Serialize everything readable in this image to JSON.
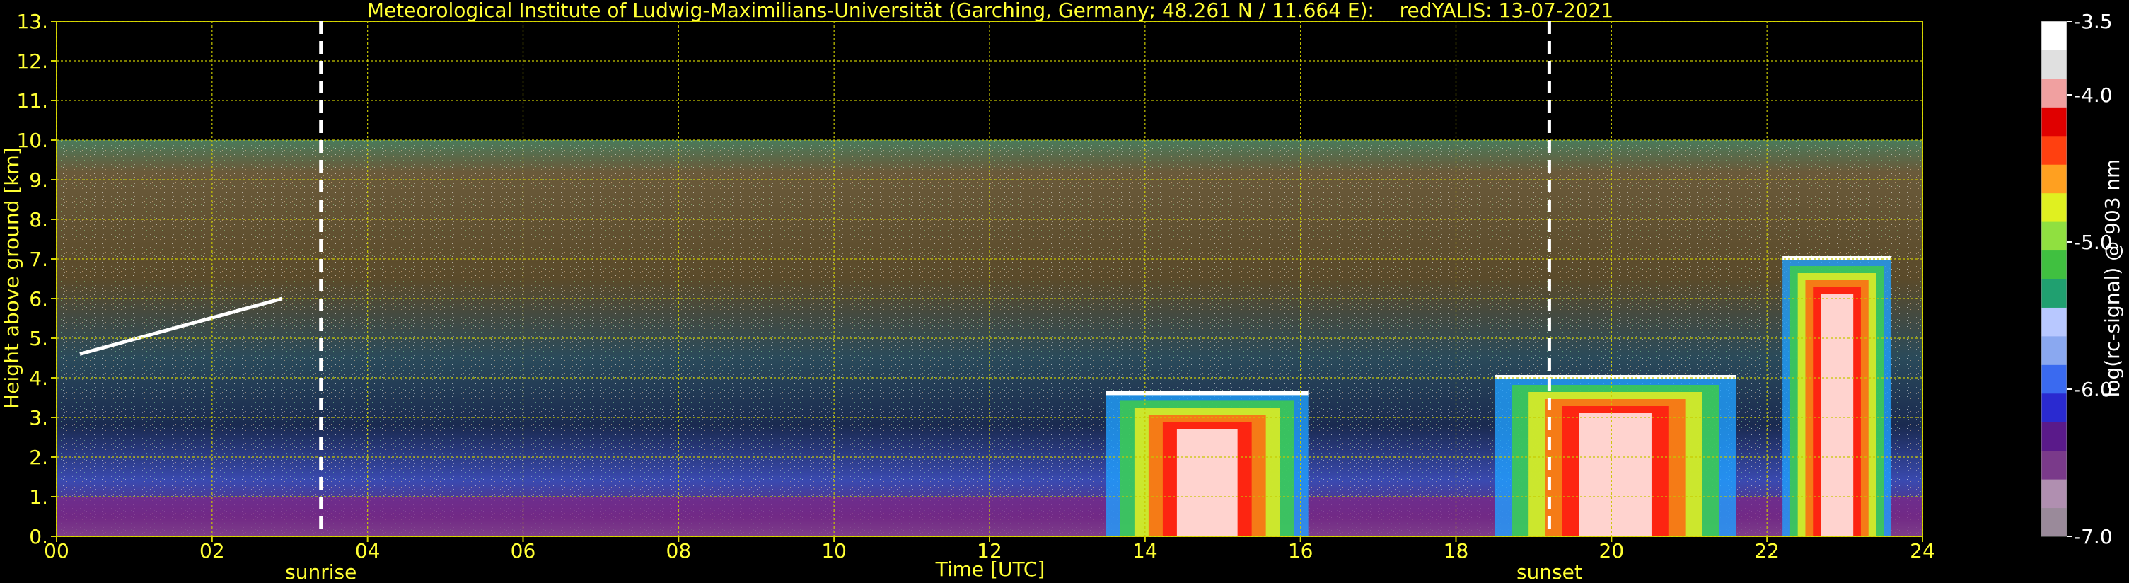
{
  "chart_data": {
    "type": "heatmap",
    "title": "Meteorological Institute of Ludwig-Maximilians-Universität (Garching, Germany; 48.261 N / 11.664 E):    redYALIS: 13-07-2021",
    "xlabel": "Time [UTC]",
    "ylabel": "Height above ground [km]",
    "xlim": [
      0,
      24
    ],
    "ylim": [
      0,
      13
    ],
    "x_ticks": [
      "00",
      "02",
      "04",
      "06",
      "08",
      "10",
      "12",
      "14",
      "16",
      "18",
      "20",
      "22",
      "24"
    ],
    "y_ticks": [
      "0.",
      "1.",
      "2.",
      "3.",
      "4.",
      "5.",
      "6.",
      "7.",
      "8.",
      "9.",
      "10.",
      "11.",
      "12.",
      "13."
    ],
    "grid": true,
    "data_top_km": 10,
    "annotations": [
      {
        "label": "sunrise",
        "x": 3.4
      },
      {
        "label": "sunset",
        "x": 19.2
      }
    ],
    "colorbar": {
      "label": "log(rc-signal) @ 903 nm",
      "range": [
        -7.0,
        -3.5
      ],
      "ticks": [
        "-3.5",
        "-4.0",
        "-5.0",
        "-6.0",
        "-7.0"
      ],
      "tick_values": [
        -3.5,
        -4.0,
        -5.0,
        -6.0,
        -7.0
      ],
      "colors": [
        "#9a8a9a",
        "#b08fb0",
        "#7a3a8a",
        "#5a1a8a",
        "#2a2ad0",
        "#3a6af0",
        "#8aa8f0",
        "#b8c8ff",
        "#20a070",
        "#40c040",
        "#90e040",
        "#e0f020",
        "#ffa020",
        "#ff4010",
        "#e00000",
        "#f0a0a0",
        "#e0e0e0",
        "#ffffff"
      ]
    },
    "features": [
      {
        "type": "cloud_layer",
        "x_start": 0.3,
        "x_end": 2.9,
        "height_start_km": 4.6,
        "height_end_km": 6.0
      },
      {
        "type": "aerosol_layer",
        "x_start": 0,
        "x_end": 24,
        "height_km": 1.0
      },
      {
        "type": "cloud",
        "x_start": 13.5,
        "x_end": 16.1,
        "base_km": 0.0,
        "top_km": 3.6
      },
      {
        "type": "cloud",
        "x_start": 18.5,
        "x_end": 21.6,
        "base_km": 0.0,
        "top_km": 4.0
      },
      {
        "type": "cloud",
        "x_start": 22.2,
        "x_end": 23.6,
        "base_km": 0.0,
        "top_km": 7.0
      }
    ]
  }
}
